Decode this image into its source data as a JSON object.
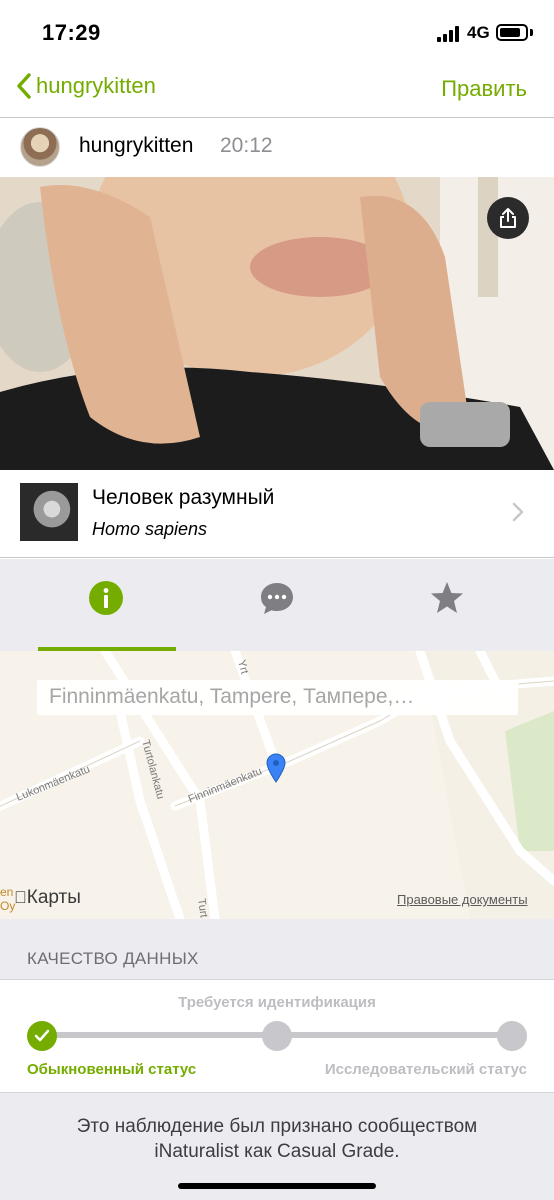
{
  "status_bar": {
    "time": "17:29",
    "network": "4G"
  },
  "nav": {
    "back_label": "hungrykitten",
    "edit_label": "Править"
  },
  "observation": {
    "user": "hungrykitten",
    "time": "20:12"
  },
  "taxon": {
    "common_name": "Человек разумный",
    "scientific_name": "Homo sapiens"
  },
  "tabs": [
    {
      "name": "info",
      "icon": "info-icon",
      "selected": true
    },
    {
      "name": "comments",
      "icon": "chat-bubble-icon",
      "selected": false
    },
    {
      "name": "favorites",
      "icon": "star-icon",
      "selected": false
    }
  ],
  "map": {
    "location_text": "Finninmäenkatu, Tampere, Тампере,…",
    "streets": [
      "Lukonmäenkatu",
      "Turtolankatu",
      "Finninmäenkatu",
      "Yrt",
      "Turt"
    ],
    "corner_label": [
      "en",
      "Oy"
    ],
    "maps_logo": "Карты",
    "legal_link": "Правовые документы"
  },
  "data_quality": {
    "section_title": "КАЧЕСТВО ДАННЫХ",
    "middle_label": "Требуется идентификация",
    "left_label": "Обыкновенный статус",
    "right_label": "Исследовательский статус"
  },
  "footer_note": "Это наблюдение был признано сообществом iNaturalist как Casual Grade.",
  "colors": {
    "accent": "#74ac00",
    "inactive": "#c7c7cc",
    "background_gray": "#ececf0",
    "pin": "#3b82f6"
  }
}
